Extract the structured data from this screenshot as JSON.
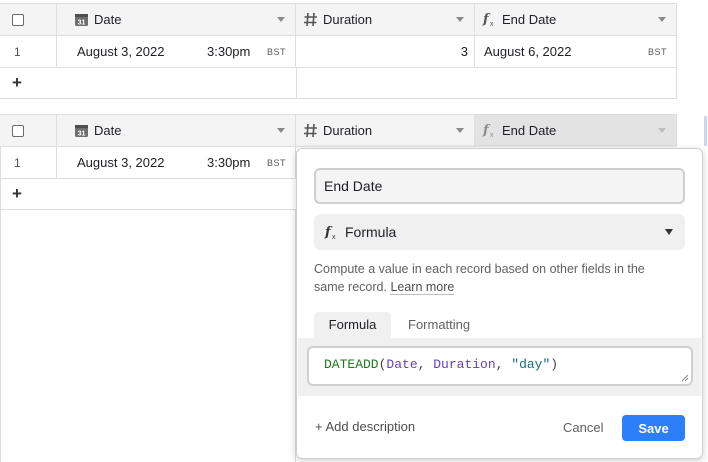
{
  "grid_top": {
    "columns": [
      {
        "name": "Date",
        "icon": "calendar-icon"
      },
      {
        "name": "Duration",
        "icon": "hash-icon"
      },
      {
        "name": "End Date",
        "icon": "formula-icon"
      }
    ],
    "rows": [
      {
        "num": "1",
        "date": "August 3, 2022",
        "time": "3:30pm",
        "tz": "BST",
        "duration": "3",
        "end_date": "August 6, 2022",
        "end_tz": "BST"
      }
    ],
    "add_row": "+"
  },
  "grid_bottom": {
    "columns": [
      {
        "name": "Date",
        "icon": "calendar-icon"
      },
      {
        "name": "Duration",
        "icon": "hash-icon"
      },
      {
        "name": "End Date",
        "icon": "formula-icon"
      }
    ],
    "rows": [
      {
        "num": "1",
        "date": "August 3, 2022",
        "time": "3:30pm",
        "tz": "BST"
      }
    ],
    "add_row": "+"
  },
  "field_editor": {
    "name_value": "End Date",
    "type_label": "Formula",
    "description_text": "Compute a value in each record based on other fields in the same record.",
    "learn_more": "Learn more",
    "tabs": [
      "Formula",
      "Formatting"
    ],
    "formula": {
      "fn": "DATEADD",
      "open": "(",
      "arg1": "Date",
      "sep1": ", ",
      "arg2": "Duration",
      "sep2": ", ",
      "arg3": "\"day\"",
      "close": ")"
    },
    "add_description": "+ Add description",
    "cancel": "Cancel",
    "save": "Save"
  },
  "colors": {
    "accent": "#2d7ff9",
    "formula_fn": "#1f7a1f",
    "formula_field": "#6a3ec2",
    "formula_string": "#12727a"
  }
}
